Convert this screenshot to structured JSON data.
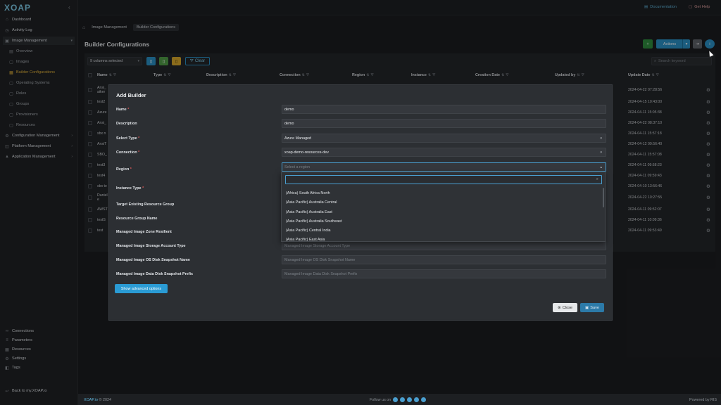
{
  "app": {
    "logo": "XOAP"
  },
  "topbar": {
    "documentation": "Documentation",
    "get_help": "Get Help"
  },
  "sidebar": {
    "items": [
      {
        "label": "Dashboard",
        "icon": "home-icon"
      },
      {
        "label": "Activity Log",
        "icon": "clock-icon"
      },
      {
        "label": "Image Management",
        "icon": "image-icon"
      },
      {
        "label": "Overview"
      },
      {
        "label": "Images"
      },
      {
        "label": "Builder Configurations"
      },
      {
        "label": "Operating Systems"
      },
      {
        "label": "Roles"
      },
      {
        "label": "Groups"
      },
      {
        "label": "Provisioners"
      },
      {
        "label": "Resources"
      },
      {
        "label": "Configuration Management"
      },
      {
        "label": "Platform Management"
      },
      {
        "label": "Application Management"
      }
    ],
    "bottom": [
      "Connections",
      "Parameters",
      "Resources",
      "Settings",
      "Tags"
    ],
    "back": "Back to my.XOAP.io"
  },
  "breadcrumb": [
    "Image Management",
    "Builder Configurations"
  ],
  "page": {
    "title": "Builder Configurations"
  },
  "toolbar": {
    "actions": "Actions",
    "columns_selected": "9 columns selected",
    "clear": "Clear",
    "search_placeholder": "Search keyword"
  },
  "table": {
    "headers": [
      "Name",
      "Type",
      "Description",
      "Connection",
      "Region",
      "Instance",
      "Creation Date",
      "Updated by",
      "Update Date"
    ],
    "names": [
      "Ansi_ aiker",
      "test2",
      "Azure",
      "Ansi_",
      "sbx n",
      "AnsiT",
      "SBO_",
      "test3",
      "test4",
      "sbx te",
      "Daniel e",
      "AWST",
      "testS",
      "test"
    ],
    "update_dates": [
      "2024-04-22 07:28:56",
      "2024-04-15 10:43:00",
      "2024-04-11 15:05:38",
      "2024-04-22 08:37:10",
      "2024-04-11 15:57:18",
      "2024-04-12 09:56:40",
      "2024-04-11 15:57:08",
      "2024-04-11 09:58:23",
      "2024-04-11 09:59:43",
      "2024-04-10 13:56:46",
      "2024-04-22 10:27:55",
      "2024-04-11 09:52:07",
      "2024-04-11 10:09:36",
      "2024-04-11 09:53:49"
    ]
  },
  "modal": {
    "title": "Add Builder",
    "fields": [
      {
        "label": "Name",
        "required": true,
        "value": "demo",
        "placeholder": ""
      },
      {
        "label": "Description",
        "required": false,
        "value": "demo",
        "placeholder": ""
      },
      {
        "label": "Select Type",
        "required": true,
        "value": "Azure Managed",
        "placeholder": ""
      },
      {
        "label": "Connection",
        "required": true,
        "value": "xoap-demo-resources-dev",
        "placeholder": ""
      },
      {
        "label": "Region",
        "required": true,
        "value": "",
        "placeholder": "Select a region"
      },
      {
        "label": "Instance Type",
        "required": true,
        "value": "",
        "placeholder": ""
      },
      {
        "label": "Target Existing Resource Group",
        "required": false,
        "value": "",
        "placeholder": ""
      },
      {
        "label": "Resource Group Name",
        "required": false,
        "value": "",
        "placeholder": ""
      },
      {
        "label": "Managed Image Zone Resilient",
        "required": false,
        "value": "",
        "placeholder": ""
      },
      {
        "label": "Managed Image Storage Account Type",
        "required": false,
        "value": "",
        "placeholder": "Managed Image Storage Account Type"
      },
      {
        "label": "Managed Image OS Disk Snapshot Name",
        "required": false,
        "value": "",
        "placeholder": "Managed Image OS Disk Snapshot Name"
      },
      {
        "label": "Managed Image Data Disk Snapshot Prefix",
        "required": false,
        "value": "",
        "placeholder": "Managed Image Data Disk Snapshot Prefix"
      }
    ],
    "region_options": [
      "(Africa) South Africa North",
      "(Asia Pacific) Australia Central",
      "(Asia Pacific) Australia East",
      "(Asia Pacific) Australia Southeast",
      "(Asia Pacific) Central India",
      "(Asia Pacific) East Asia"
    ],
    "advanced": "Show advanced options",
    "close": "Close",
    "save": "Save"
  },
  "footer": {
    "brand": "XOAP.io",
    "copyright": "© 2024",
    "follow": "Follow us on",
    "powered": "Powered by RIS"
  },
  "colors": {
    "accent": "#2a8fc4",
    "required": "#e05a5a",
    "active_nav": "#e2b23a"
  }
}
